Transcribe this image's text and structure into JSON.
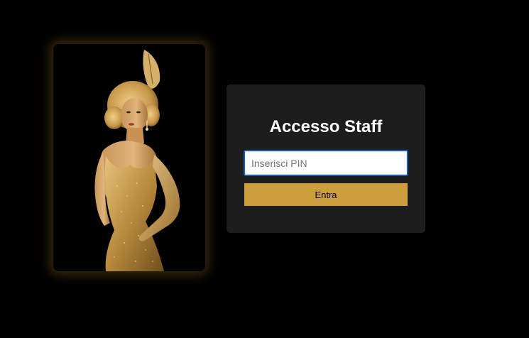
{
  "login": {
    "title": "Accesso Staff",
    "pin_placeholder": "Inserisci PIN",
    "pin_value": "",
    "enter_label": "Entra"
  },
  "colors": {
    "background": "#000000",
    "panel": "#1d1d1d",
    "accent_gold": "#cc9e3c",
    "input_focus_border": "#1b5fb3"
  },
  "portrait": {
    "icon": "flapper-woman-illustration"
  }
}
